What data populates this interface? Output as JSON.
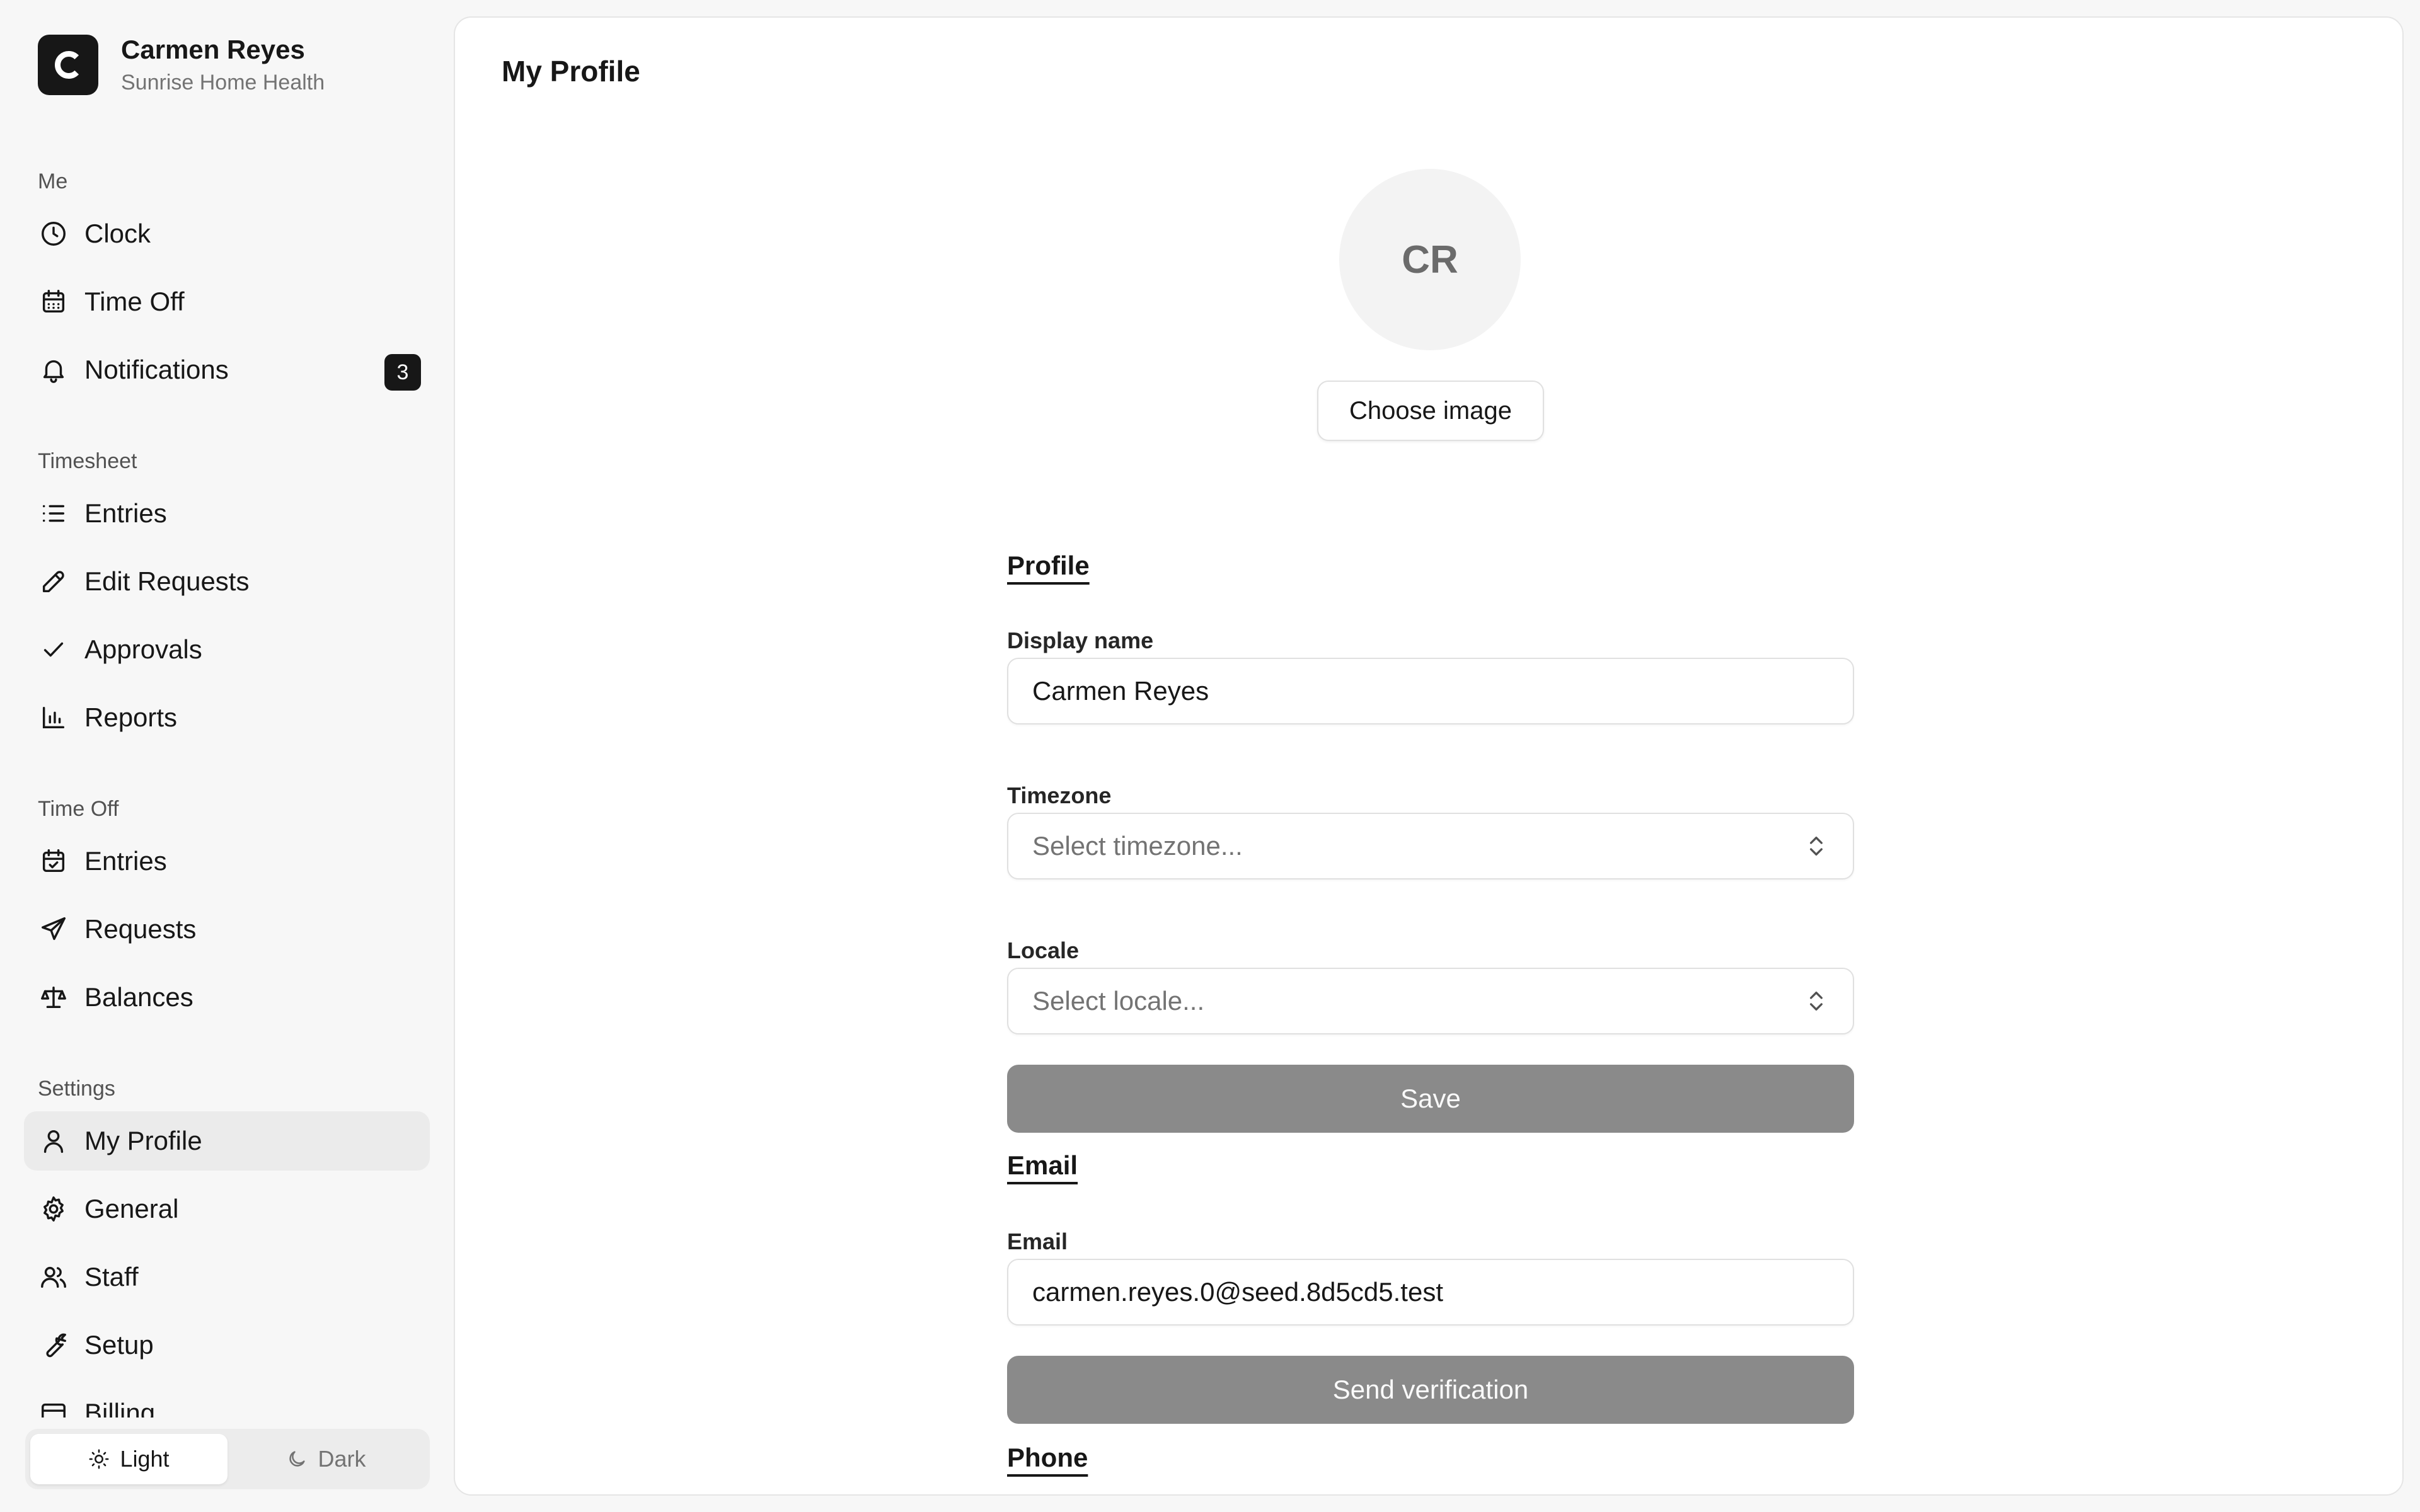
{
  "brand": {
    "initial": "C",
    "name": "Carmen Reyes",
    "org": "Sunrise Home Health"
  },
  "nav": {
    "me": {
      "label": "Me",
      "items": [
        {
          "label": "Clock",
          "icon": "clock-icon"
        },
        {
          "label": "Time Off",
          "icon": "calendar-icon"
        },
        {
          "label": "Notifications",
          "icon": "bell-icon",
          "badge": "3"
        }
      ]
    },
    "timesheet": {
      "label": "Timesheet",
      "items": [
        {
          "label": "Entries",
          "icon": "list-icon"
        },
        {
          "label": "Edit Requests",
          "icon": "pencil-icon"
        },
        {
          "label": "Approvals",
          "icon": "check-icon"
        },
        {
          "label": "Reports",
          "icon": "bar-chart-icon"
        }
      ]
    },
    "timeoff": {
      "label": "Time Off",
      "items": [
        {
          "label": "Entries",
          "icon": "calendar-check-icon"
        },
        {
          "label": "Requests",
          "icon": "send-icon"
        },
        {
          "label": "Balances",
          "icon": "scale-icon"
        }
      ]
    },
    "settings": {
      "label": "Settings",
      "items": [
        {
          "label": "My Profile",
          "icon": "user-icon",
          "active": true
        },
        {
          "label": "General",
          "icon": "gear-icon"
        },
        {
          "label": "Staff",
          "icon": "users-icon"
        },
        {
          "label": "Setup",
          "icon": "wrench-icon"
        },
        {
          "label": "Billing",
          "icon": "credit-card-icon"
        }
      ]
    }
  },
  "theme": {
    "light": "Light",
    "dark": "Dark",
    "selected": "Light"
  },
  "page": {
    "title": "My Profile"
  },
  "avatar": {
    "initials": "CR",
    "choose_label": "Choose image"
  },
  "profile": {
    "section": "Profile",
    "display_name_label": "Display name",
    "display_name_value": "Carmen Reyes",
    "timezone_label": "Timezone",
    "timezone_placeholder": "Select timezone...",
    "locale_label": "Locale",
    "locale_placeholder": "Select locale...",
    "save_label": "Save"
  },
  "email": {
    "section": "Email",
    "label": "Email",
    "value": "carmen.reyes.0@seed.8d5cd5.test",
    "verify_label": "Send verification"
  },
  "phone": {
    "section": "Phone"
  }
}
